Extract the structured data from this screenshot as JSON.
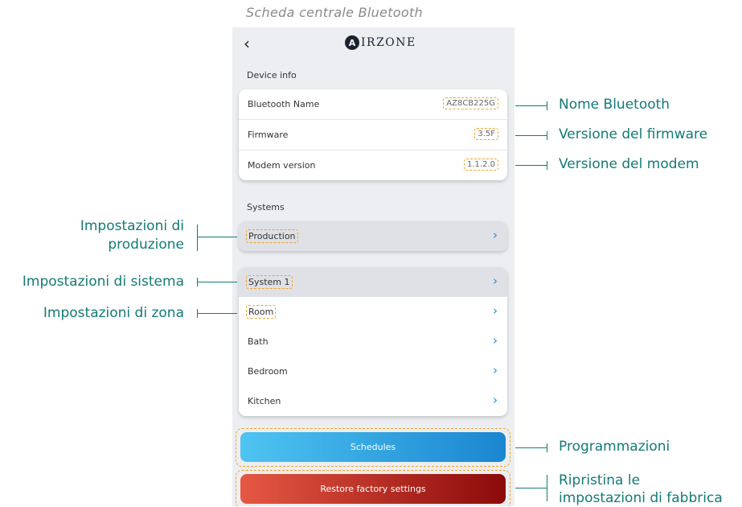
{
  "caption": "Scheda centrale Bluetooth",
  "header": {
    "back_icon": "‹",
    "logo_mark": "A",
    "logo_text": "IRZONE"
  },
  "device_info": {
    "title": "Device info",
    "rows": [
      {
        "label": "Bluetooth Name",
        "value": "AZ8CB225G"
      },
      {
        "label": "Firmware",
        "value": "3.5F"
      },
      {
        "label": "Modem version",
        "value": "1.1.2.0"
      }
    ]
  },
  "systems": {
    "title": "Systems",
    "production": "Production",
    "system_name": "System 1",
    "zones": [
      "Room",
      "Bath",
      "Bedroom",
      "Kitchen"
    ]
  },
  "buttons": {
    "schedules": "Schedules",
    "restore": "Restore factory settings"
  },
  "annotations": {
    "bluetooth_name": "Nome Bluetooth",
    "firmware": "Versione del firmware",
    "modem": "Versione del modem",
    "production_1": "Impostazioni di",
    "production_2": "produzione",
    "system": "Impostazioni di sistema",
    "zone": "Impostazioni di zona",
    "schedules": "Programmazioni",
    "restore_1": "Ripristina le",
    "restore_2": "impostazioni di fabbrica"
  },
  "colors": {
    "annotation": "#137a78",
    "chevron": "#1c8fd3",
    "dash": "#f0a431"
  }
}
